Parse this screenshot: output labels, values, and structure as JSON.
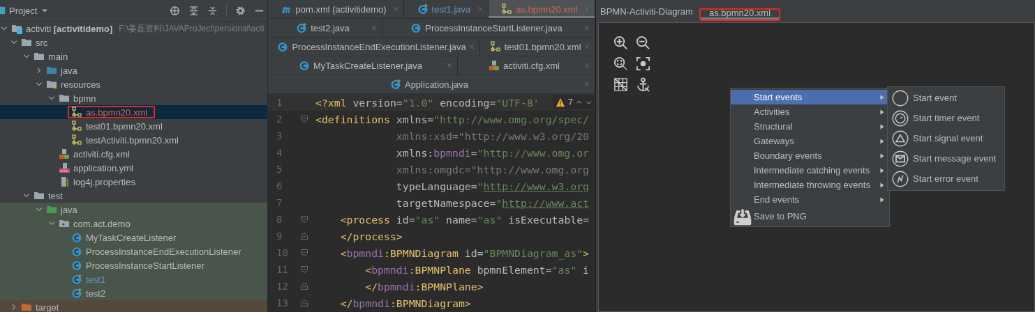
{
  "project_panel": {
    "title": "Project",
    "tree": [
      {
        "label": "activiti **[activitidemo]**",
        "path": "F:\\姜磊资料\\JAVAProJect\\persional\\acti",
        "kind": "module",
        "expanded": true,
        "selected": false,
        "color": "#bbbbbb",
        "children": [
          {
            "label": "src",
            "kind": "folder",
            "expanded": true,
            "selected": false,
            "color": "#bbbbbb",
            "children": [
              {
                "label": "main",
                "kind": "folder",
                "expanded": true,
                "selected": false,
                "color": "#bbbbbb",
                "children": [
                  {
                    "label": "java",
                    "kind": "source-folder",
                    "expanded": false,
                    "selected": false,
                    "color": "#bbbbbb"
                  },
                  {
                    "label": "resources",
                    "kind": "resources-folder",
                    "expanded": true,
                    "selected": false,
                    "color": "#bbbbbb",
                    "children": [
                      {
                        "label": "bpmn",
                        "kind": "folder",
                        "expanded": true,
                        "selected": false,
                        "color": "#bbbbbb",
                        "children": [
                          {
                            "label": "as.bpmn20.xml",
                            "kind": "bpmn",
                            "selected": true,
                            "color": "#d1675a",
                            "annotated": true
                          },
                          {
                            "label": "test01.bpmn20.xml",
                            "kind": "bpmn",
                            "selected": false,
                            "color": "#bbbbbb"
                          },
                          {
                            "label": "testActiviti.bpmn20.xml",
                            "kind": "bpmn",
                            "selected": false,
                            "color": "#bbbbbb"
                          }
                        ]
                      },
                      {
                        "label": "activiti.cfg.xml",
                        "kind": "spring-xml",
                        "selected": false,
                        "color": "#bbbbbb"
                      },
                      {
                        "label": "application.yml",
                        "kind": "yml",
                        "selected": false,
                        "color": "#bbbbbb"
                      },
                      {
                        "label": "log4j.properties",
                        "kind": "properties",
                        "selected": false,
                        "color": "#bbbbbb"
                      }
                    ]
                  }
                ]
              },
              {
                "label": "test",
                "kind": "folder",
                "expanded": true,
                "selected": false,
                "color": "#bbbbbb",
                "children": [
                  {
                    "label": "java",
                    "kind": "test-folder",
                    "expanded": true,
                    "selected": false,
                    "color": "#bbbbbb",
                    "test": true,
                    "children": [
                      {
                        "label": "com.act.demo",
                        "kind": "package",
                        "expanded": true,
                        "selected": false,
                        "color": "#bbbbbb",
                        "test": true,
                        "children": [
                          {
                            "label": "MyTaskCreateListener",
                            "kind": "class",
                            "selected": false,
                            "color": "#bbbbbb",
                            "test": true
                          },
                          {
                            "label": "ProcessInstanceEndExecutionListener",
                            "kind": "class",
                            "selected": false,
                            "color": "#bbbbbb",
                            "test": true
                          },
                          {
                            "label": "ProcessInstanceStartListener",
                            "kind": "class",
                            "selected": false,
                            "color": "#bbbbbb",
                            "test": true
                          },
                          {
                            "label": "test1",
                            "kind": "class-run",
                            "selected": false,
                            "color": "#6897bb",
                            "test": true
                          },
                          {
                            "label": "test2",
                            "kind": "class-run",
                            "selected": false,
                            "color": "#bbbbbb",
                            "test": true
                          }
                        ]
                      }
                    ]
                  }
                ]
              }
            ]
          },
          {
            "label": "target",
            "kind": "excluded-folder",
            "expanded": false,
            "selected": false,
            "color": "#bbbbbb",
            "excluded": true
          }
        ]
      }
    ]
  },
  "editor": {
    "tab_rows": [
      [
        {
          "label": "pom.xml (activitidemo)",
          "kind": "maven",
          "selected": false,
          "color": "#bbbbbb"
        },
        {
          "label": "test1.java",
          "kind": "class-run",
          "selected": false,
          "color": "#6897bb"
        },
        {
          "label": "as.bpmn20.xml",
          "kind": "bpmn",
          "selected": true,
          "color": "#d1675a"
        }
      ],
      [
        {
          "label": "test2.java",
          "kind": "class-run",
          "selected": false,
          "color": "#bbbbbb"
        },
        {
          "label": "ProcessInstanceStartListener.java",
          "kind": "class",
          "selected": false,
          "color": "#bbbbbb"
        }
      ],
      [
        {
          "label": "ProcessInstanceEndExecutionListener.java",
          "kind": "class",
          "selected": false,
          "color": "#bbbbbb"
        },
        {
          "label": "test01.bpmn20.xml",
          "kind": "bpmn",
          "selected": false,
          "color": "#bbbbbb"
        }
      ],
      [
        {
          "label": "MyTaskCreateListener.java",
          "kind": "class",
          "selected": false,
          "color": "#bbbbbb"
        },
        {
          "label": "activiti.cfg.xml",
          "kind": "spring-xml",
          "selected": false,
          "color": "#bbbbbb"
        }
      ],
      [
        {
          "label": "Application.java",
          "kind": "class-run",
          "selected": false,
          "color": "#bbbbbb"
        }
      ]
    ],
    "warnings": "7",
    "lines": [
      {
        "number": "1",
        "kind": "plain",
        "tokens": [
          {
            "kind": "tag",
            "text": "<?xml "
          },
          {
            "kind": "attr",
            "text": "version"
          },
          {
            "kind": "plain",
            "text": "="
          },
          {
            "kind": "value",
            "text": "\"1.0\" "
          },
          {
            "kind": "attr",
            "text": "encoding"
          },
          {
            "kind": "plain",
            "text": "="
          },
          {
            "kind": "value",
            "text": "\"UTF-8'"
          }
        ]
      },
      {
        "number": "2",
        "kind": "fold-start",
        "tokens": [
          {
            "kind": "tag",
            "text": "<definitions "
          },
          {
            "kind": "attr",
            "text": "xmlns"
          },
          {
            "kind": "plain",
            "text": "="
          },
          {
            "kind": "value",
            "text": "\"http://www.omg.org/spec/"
          }
        ]
      },
      {
        "number": "3",
        "kind": "plain",
        "tokens": [
          {
            "kind": "unused",
            "text": "             xmlns:xsd=\"http://www.w3.org/20"
          }
        ]
      },
      {
        "number": "4",
        "kind": "plain",
        "tokens": [
          {
            "kind": "attr",
            "text": "             xmlns:"
          },
          {
            "kind": "ns",
            "text": "bpmndi"
          },
          {
            "kind": "plain",
            "text": "="
          },
          {
            "kind": "value",
            "text": "\"http://www.omg.or"
          }
        ]
      },
      {
        "number": "5",
        "kind": "plain",
        "tokens": [
          {
            "kind": "unused",
            "text": "             xmlns:omgdc=\"http://www.omg.org"
          }
        ]
      },
      {
        "number": "6",
        "kind": "plain",
        "tokens": [
          {
            "kind": "attr",
            "text": "             typeLanguage"
          },
          {
            "kind": "plain",
            "text": "="
          },
          {
            "kind": "value",
            "text": "\""
          },
          {
            "kind": "url",
            "text": "http://www.w3.org"
          }
        ]
      },
      {
        "number": "7",
        "kind": "plain",
        "tokens": [
          {
            "kind": "attr",
            "text": "             targetNamespace"
          },
          {
            "kind": "plain",
            "text": "="
          },
          {
            "kind": "value",
            "text": "\""
          },
          {
            "kind": "url",
            "text": "http://www.act"
          }
        ]
      },
      {
        "number": "8",
        "kind": "fold-start",
        "tokens": [
          {
            "kind": "tag",
            "text": "    <process "
          },
          {
            "kind": "attr",
            "text": "id"
          },
          {
            "kind": "plain",
            "text": "="
          },
          {
            "kind": "value",
            "text": "\"as\" "
          },
          {
            "kind": "attr",
            "text": "name"
          },
          {
            "kind": "plain",
            "text": "="
          },
          {
            "kind": "value",
            "text": "\"as\" "
          },
          {
            "kind": "attr",
            "text": "isExecutable"
          },
          {
            "kind": "plain",
            "text": "="
          }
        ]
      },
      {
        "number": "9",
        "kind": "fold-end",
        "tokens": [
          {
            "kind": "tag",
            "text": "    </process>"
          }
        ]
      },
      {
        "number": "10",
        "kind": "fold-start",
        "tokens": [
          {
            "kind": "tag",
            "text": "    <"
          },
          {
            "kind": "ns",
            "text": "bpmndi"
          },
          {
            "kind": "tag",
            "text": ":BPMNDiagram "
          },
          {
            "kind": "attr",
            "text": "id"
          },
          {
            "kind": "plain",
            "text": "="
          },
          {
            "kind": "value",
            "text": "\"BPMNDiagram_as\""
          },
          {
            "kind": "tag",
            "text": ">"
          }
        ]
      },
      {
        "number": "11",
        "kind": "fold-start",
        "tokens": [
          {
            "kind": "tag",
            "text": "        <"
          },
          {
            "kind": "ns",
            "text": "bpmndi"
          },
          {
            "kind": "tag",
            "text": ":BPMNPlane "
          },
          {
            "kind": "attr",
            "text": "bpmnElement"
          },
          {
            "kind": "plain",
            "text": "="
          },
          {
            "kind": "value",
            "text": "\"as\" "
          },
          {
            "kind": "attr",
            "text": "i"
          }
        ]
      },
      {
        "number": "12",
        "kind": "fold-end",
        "tokens": [
          {
            "kind": "tag",
            "text": "        </"
          },
          {
            "kind": "ns",
            "text": "bpmndi"
          },
          {
            "kind": "tag",
            "text": ":BPMNPlane>"
          }
        ]
      },
      {
        "number": "13",
        "kind": "fold-end",
        "tokens": [
          {
            "kind": "tag",
            "text": "    </"
          },
          {
            "kind": "ns",
            "text": "bpmndi"
          },
          {
            "kind": "tag",
            "text": ":BPMNDiagram>"
          }
        ]
      }
    ]
  },
  "diagram": {
    "tabs": [
      {
        "label": "BPMN-Activiti-Diagram",
        "selected": false
      },
      {
        "label": "as.bpmn20.xml",
        "selected": true,
        "annotated": true
      }
    ],
    "context_menu": [
      {
        "label": "Start events",
        "kind": "submenu",
        "selected": true
      },
      {
        "label": "Activities",
        "kind": "submenu",
        "selected": false
      },
      {
        "label": "Structural",
        "kind": "submenu",
        "selected": false
      },
      {
        "label": "Gateways",
        "kind": "submenu",
        "selected": false
      },
      {
        "label": "Boundary events",
        "kind": "submenu",
        "selected": false
      },
      {
        "label": "Intermediate catching events",
        "kind": "submenu",
        "selected": false
      },
      {
        "label": "Intermediate throwing events",
        "kind": "submenu",
        "selected": false
      },
      {
        "label": "End events",
        "kind": "submenu",
        "selected": false
      },
      {
        "label": "Save to PNG",
        "kind": "action",
        "selected": false
      }
    ],
    "submenu": [
      {
        "label": "Start event",
        "kind": "plain"
      },
      {
        "label": "Start timer event",
        "kind": "timer"
      },
      {
        "label": "Start signal event",
        "kind": "signal"
      },
      {
        "label": "Start message event",
        "kind": "message"
      },
      {
        "label": "Start error event",
        "kind": "error"
      }
    ]
  }
}
